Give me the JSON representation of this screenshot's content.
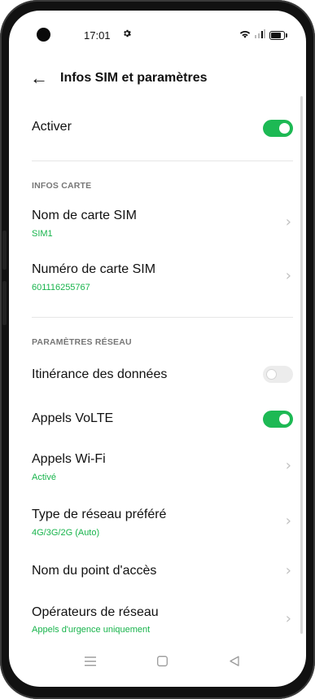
{
  "status_bar": {
    "time": "17:01",
    "settings_icon": "gear-icon",
    "wifi_icon": "wifi-icon",
    "signal_icon": "signal-icon",
    "battery_icon": "battery-icon"
  },
  "header": {
    "back_icon": "arrow-left-icon",
    "back_glyph": "←",
    "title": "Infos SIM et paramètres"
  },
  "activate": {
    "label": "Activer",
    "enabled": true
  },
  "card_info": {
    "section_title": "INFOS CARTE",
    "sim_name": {
      "label": "Nom de carte SIM",
      "value": "SIM1"
    },
    "sim_number": {
      "label": "Numéro de carte SIM",
      "value": "601116255767"
    }
  },
  "network": {
    "section_title": "PARAMÈTRES RÉSEAU",
    "roaming": {
      "label": "Itinérance des données",
      "enabled": false
    },
    "volte": {
      "label": "Appels VoLTE",
      "enabled": true
    },
    "wifi_calls": {
      "label": "Appels Wi-Fi",
      "value": "Activé"
    },
    "preferred_network": {
      "label": "Type de réseau préféré",
      "value": "4G/3G/2G (Auto)"
    },
    "apn": {
      "label": "Nom du point d'accès"
    },
    "operators": {
      "label": "Opérateurs de réseau",
      "value": "Appels d'urgence uniquement"
    }
  },
  "chevron_glyph": "›",
  "colors": {
    "accent": "#1db954",
    "subtext": "#18b44c"
  },
  "nav_bar": {
    "menu_icon": "menu-icon",
    "home_icon": "home-icon",
    "back_icon": "back-triangle-icon"
  }
}
